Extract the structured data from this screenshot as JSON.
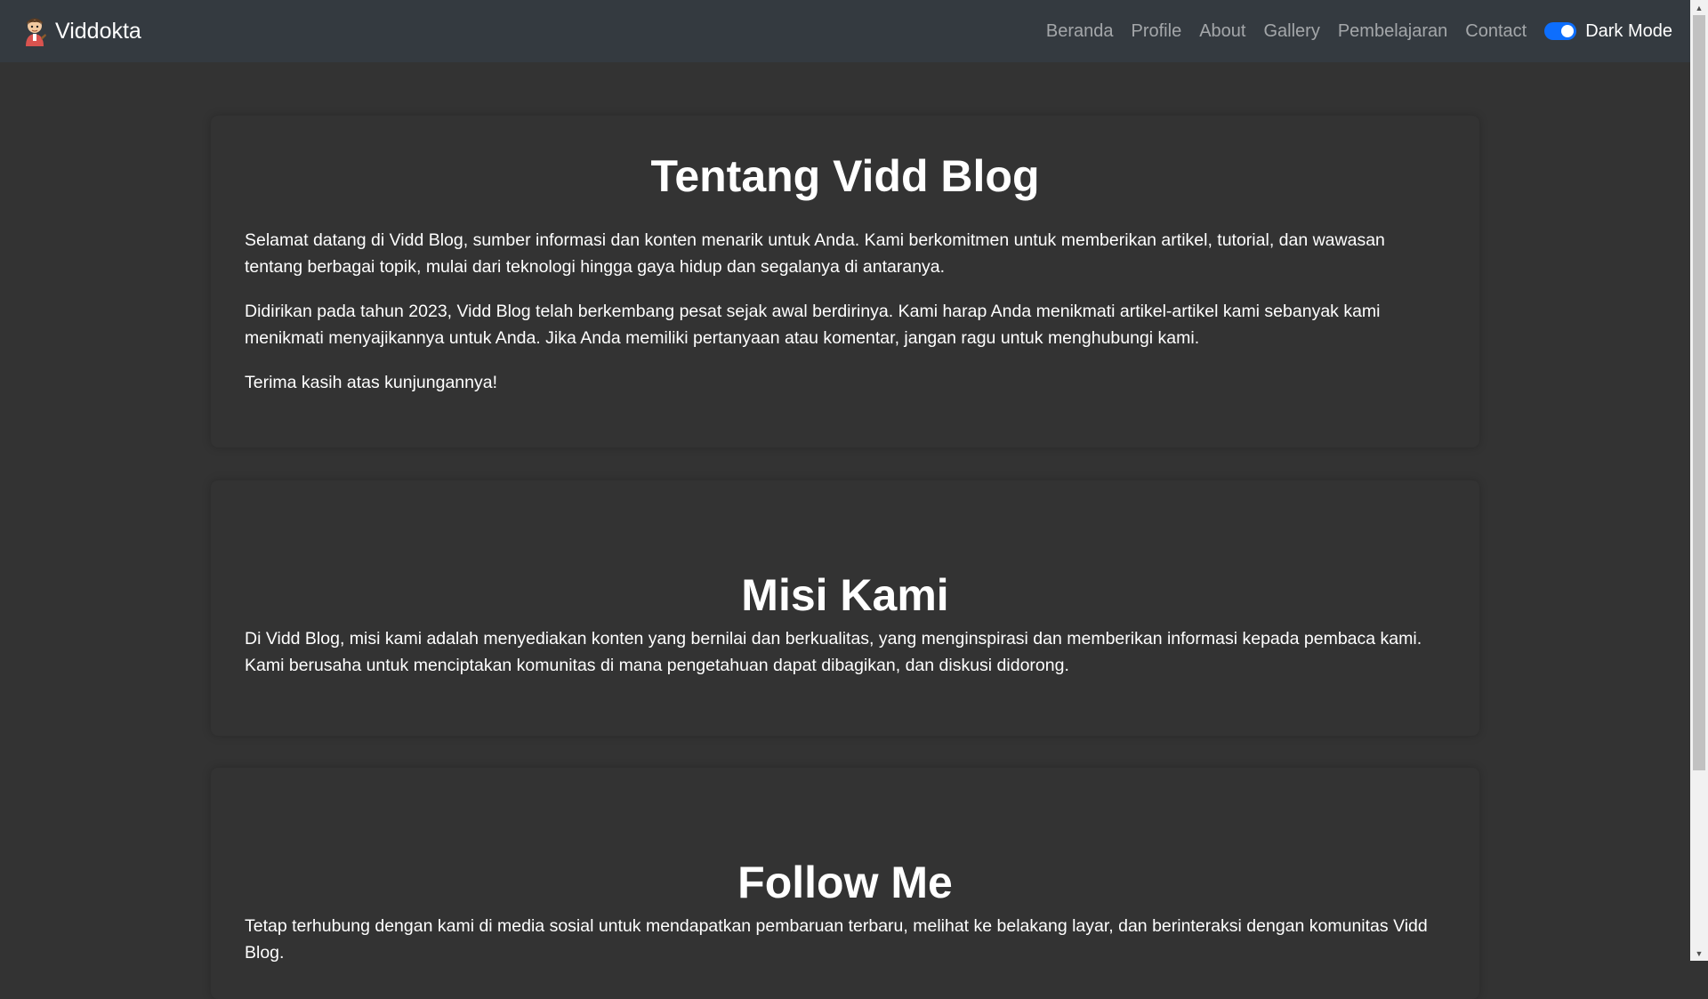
{
  "navbar": {
    "brand": "Viddokta",
    "links": [
      "Beranda",
      "Profile",
      "About",
      "Gallery",
      "Pembelajaran",
      "Contact"
    ],
    "dark_mode_label": "Dark Mode",
    "dark_mode_on": true
  },
  "about": {
    "title": "Tentang Vidd Blog",
    "paragraphs": [
      "Selamat datang di Vidd Blog, sumber informasi dan konten menarik untuk Anda. Kami berkomitmen untuk memberikan artikel, tutorial, dan wawasan tentang berbagai topik, mulai dari teknologi hingga gaya hidup dan segalanya di antaranya.",
      "Didirikan pada tahun 2023, Vidd Blog telah berkembang pesat sejak awal berdirinya. Kami harap Anda menikmati artikel-artikel kami sebanyak kami menikmati menyajikannya untuk Anda. Jika Anda memiliki pertanyaan atau komentar, jangan ragu untuk menghubungi kami.",
      "Terima kasih atas kunjungannya!"
    ]
  },
  "mission": {
    "title": "Misi Kami",
    "text": "Di Vidd Blog, misi kami adalah menyediakan konten yang bernilai dan berkualitas, yang menginspirasi dan memberikan informasi kepada pembaca kami. Kami berusaha untuk menciptakan komunitas di mana pengetahuan dapat dibagikan, dan diskusi didorong."
  },
  "follow": {
    "title": "Follow Me",
    "text": "Tetap terhubung dengan kami di media sosial untuk mendapatkan pembaruan terbaru, melihat ke belakang layar, dan berinteraksi dengan komunitas Vidd Blog."
  },
  "colors": {
    "background": "#333333",
    "navbar": "#343a40",
    "toggle_accent": "#0d6efd"
  },
  "icons": {
    "brand_logo": "cartoon-avatar-icon",
    "scroll_up": "triangle-up-icon",
    "scroll_down": "triangle-down-icon"
  }
}
